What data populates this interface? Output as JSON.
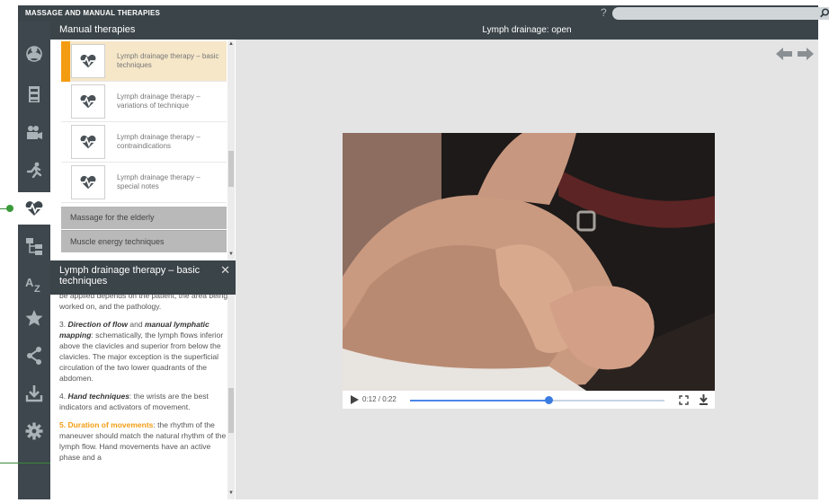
{
  "app": {
    "title": "MASSAGE AND MANUAL THERAPIES",
    "help_label": "?"
  },
  "search": {
    "placeholder": ""
  },
  "sidebar": {
    "icons": [
      "anatomy-icon",
      "book-icon",
      "video-camera-icon",
      "running-person-icon",
      "heartbeat-icon",
      "hierarchy-icon",
      "a-z-index-icon",
      "star-icon",
      "share-icon",
      "download-icon",
      "settings-gear-icon"
    ],
    "active_index": 4
  },
  "list": {
    "header": "Manual therapies",
    "items": [
      {
        "label": "Lymph drainage therapy – basic techniques",
        "selected": true
      },
      {
        "label": "Lymph drainage therapy – variations of technique",
        "selected": false
      },
      {
        "label": "Lymph drainage therapy – contraindications",
        "selected": false
      },
      {
        "label": "Lymph drainage therapy – special notes",
        "selected": false
      }
    ],
    "categories": [
      "Massage for the elderly",
      "Muscle energy techniques"
    ]
  },
  "detail": {
    "title": "Lymph drainage therapy – basic techniques",
    "close_label": "✕",
    "p1": "be applied depends on the patient, the area being worked on, and the pathology.",
    "p2_num": "3. ",
    "p2_em1": "Direction of flow",
    "p2_mid": " and ",
    "p2_em2": "manual lymphatic mapping",
    "p2_rest": ": schematically, the lymph flows inferior above the clavicles and superior from below the clavicles. The major exception is the superficial circulation of the two lower quadrants of the abdomen.",
    "p3_num": "4. ",
    "p3_em": "Hand techniques",
    "p3_rest": ": the wrists are the best indicators and activators of movement.",
    "p4_num": "5. ",
    "p4_em": "Duration of movements",
    "p4_rest": ": the rhythm of the maneuver should match the natural rhythm of the lymph flow. Hand movements have an active phase and a"
  },
  "main": {
    "header": "Lymph drainage: open"
  },
  "video": {
    "time": "0:12 / 0:22",
    "progress": 0.545
  },
  "colors": {
    "accent": "#f39c12",
    "header_bg": "#3b4449",
    "progress": "#4a86e8",
    "pointer": "#3a9a3a"
  }
}
